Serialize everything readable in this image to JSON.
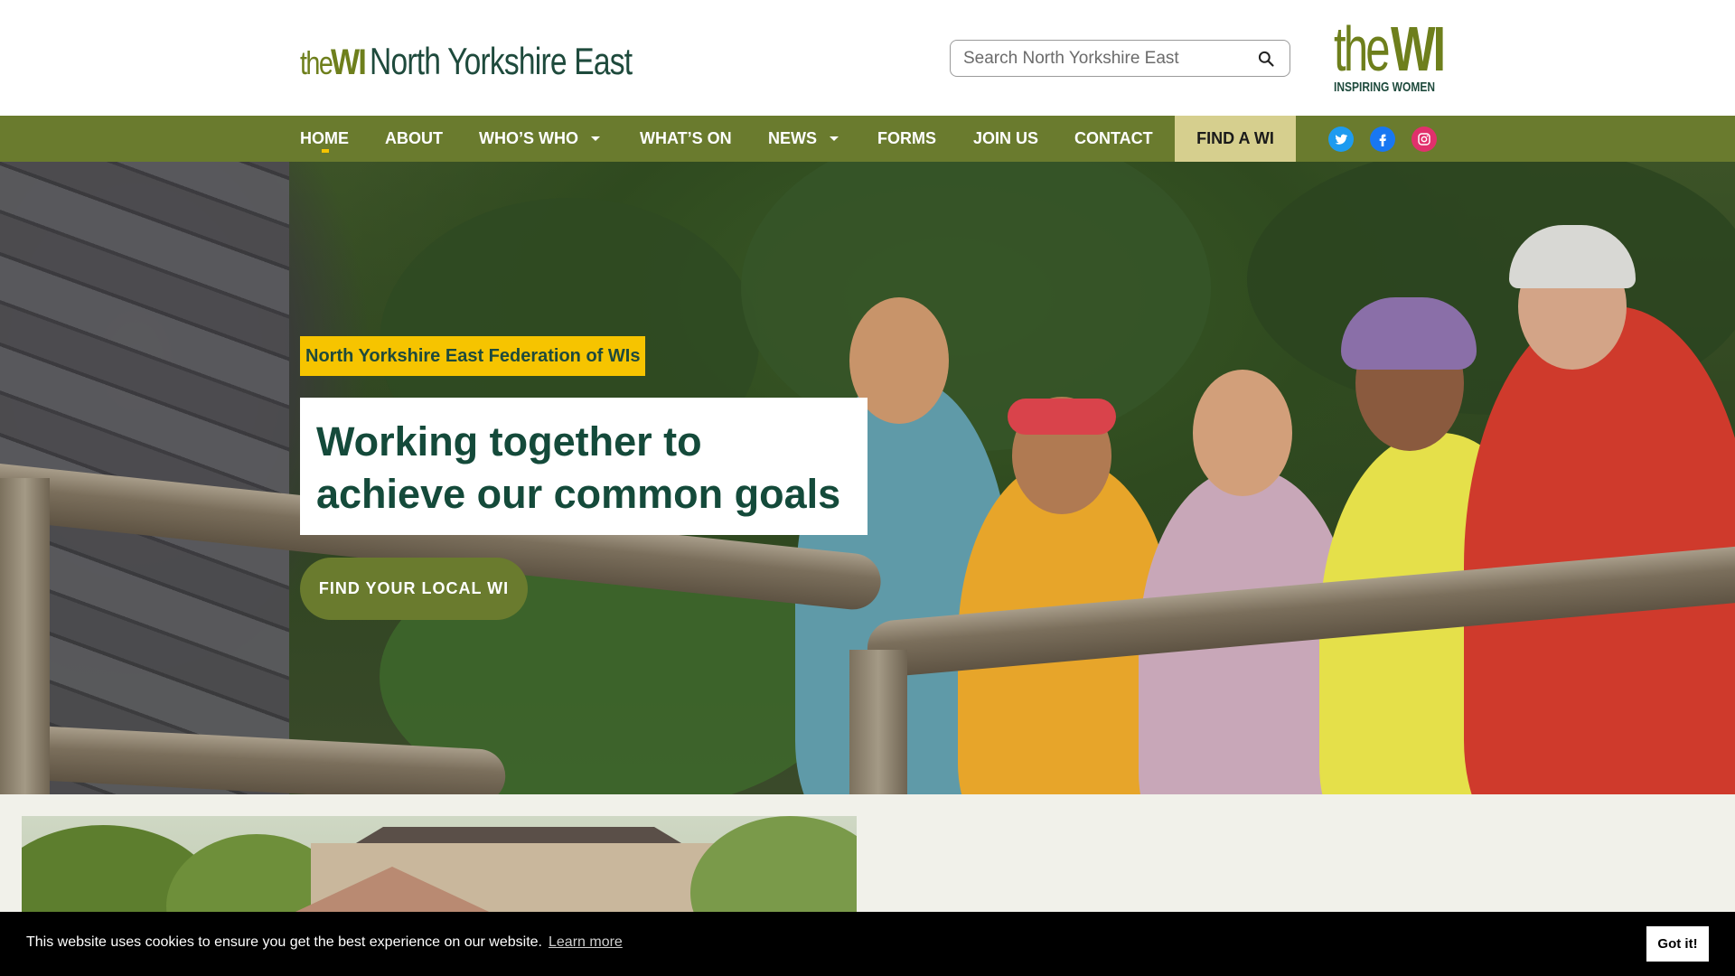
{
  "header": {
    "logo": {
      "the": "the",
      "wi": "WI",
      "name": "North Yorkshire East"
    },
    "search": {
      "placeholder": "Search North Yorkshire East",
      "icon": "search-icon"
    },
    "brand": {
      "the": "the",
      "wi": "WI",
      "tagline": "INSPIRING WOMEN"
    }
  },
  "nav": {
    "items": [
      {
        "label": "HOME",
        "active": true
      },
      {
        "label": "ABOUT"
      },
      {
        "label": "WHO’S WHO",
        "dropdown": true
      },
      {
        "label": "WHAT’S ON"
      },
      {
        "label": "NEWS",
        "dropdown": true
      },
      {
        "label": "FORMS"
      },
      {
        "label": "JOIN US"
      },
      {
        "label": "CONTACT"
      }
    ],
    "find": "FIND A WI",
    "social": [
      {
        "name": "twitter-icon",
        "color": "#1d9bf0"
      },
      {
        "name": "facebook-icon",
        "color": "#1877f2"
      },
      {
        "name": "instagram-icon",
        "color": "#e1306c"
      }
    ]
  },
  "hero": {
    "tag": "North Yorkshire East Federation of WIs",
    "title_line1": "Working together to",
    "title_line2": "achieve our common goals",
    "cta": "FIND YOUR LOCAL WI"
  },
  "cookie": {
    "text": "This website uses cookies to ensure you get the best experience on our website.",
    "link": "Learn more",
    "button": "Got it!"
  },
  "colors": {
    "nav_green": "#6a7b2e",
    "accent_yellow": "#f6c400",
    "dark_green": "#144a3a",
    "find_bg": "#d6cf8e"
  }
}
